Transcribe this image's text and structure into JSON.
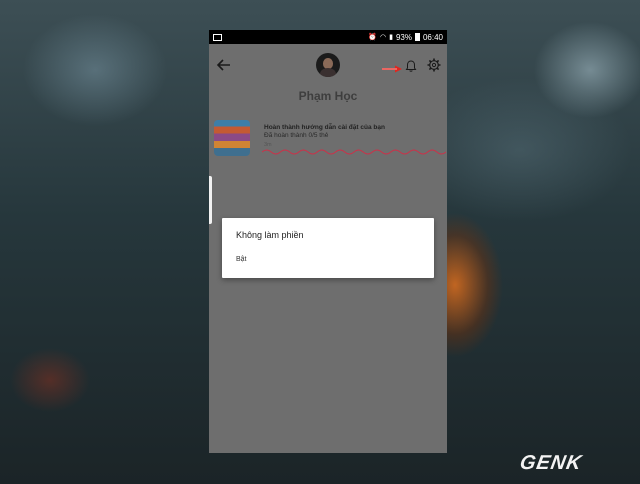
{
  "status_bar": {
    "battery": "93%",
    "time": "06:40"
  },
  "profile": {
    "name": "Phạm Học"
  },
  "task": {
    "title": "Hoàn thành hướng dẫn cài đặt của bạn",
    "subtitle": "Đã hoàn thành 0/5 thẻ",
    "time": "3m"
  },
  "dialog": {
    "title": "Không làm phiền",
    "option": "Bật"
  },
  "watermark": {
    "text": "GENK"
  },
  "colors": {
    "annotation": "#e0261f",
    "wave": "#c8334a",
    "overlay": "#6e6e6e"
  }
}
